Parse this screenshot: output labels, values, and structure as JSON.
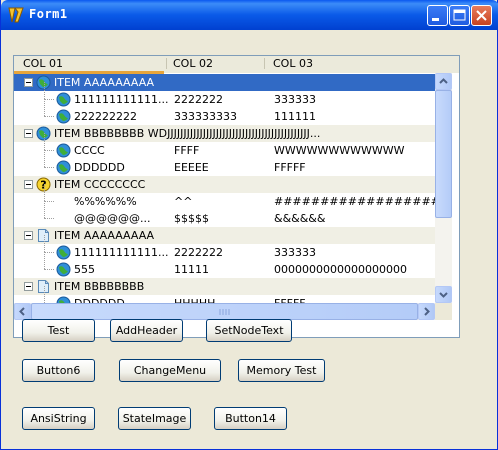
{
  "window": {
    "title": "Form1"
  },
  "columns": [
    "COL 01",
    "COL 02",
    "COL 03"
  ],
  "rows": [
    {
      "level": 0,
      "icon": "globe-icon",
      "c1": "ITEM  AAAAAAAAA",
      "c2": "",
      "c3": "",
      "selected": true
    },
    {
      "level": 1,
      "icon": "globe-icon",
      "c1": "111111111111...",
      "c2": "2222222",
      "c3": "333333"
    },
    {
      "level": 1,
      "icon": "globe-icon",
      "c1": "222222222",
      "c2": "333333333",
      "c3": "111111"
    },
    {
      "level": 0,
      "icon": "globe-icon",
      "c1": "ITEM  BBBBBBBB WDJJJJJJJJJJJJJJJJJJJJJJJJJJJJJJJJJJJJJJJJJJJJ...",
      "c2": "",
      "c3": ""
    },
    {
      "level": 1,
      "icon": "globe-icon",
      "c1": "CCCC",
      "c2": "FFFF",
      "c3": "WWWWWWWWWWWW"
    },
    {
      "level": 1,
      "icon": "globe-icon",
      "c1": "DDDDDD",
      "c2": "EEEEE",
      "c3": "FFFFF"
    },
    {
      "level": 0,
      "icon": "question-icon",
      "c1": "ITEM  CCCCCCCC",
      "c2": "",
      "c3": ""
    },
    {
      "level": 1,
      "icon": "",
      "c1": "%%%%%%",
      "c2": "^^",
      "c3": "##############################"
    },
    {
      "level": 1,
      "icon": "",
      "c1": "@@@@@@...",
      "c2": "$$$$$",
      "c3": "&&&&&&"
    },
    {
      "level": 0,
      "icon": "document-icon",
      "c1": "ITEM  AAAAAAAAA",
      "c2": "",
      "c3": ""
    },
    {
      "level": 1,
      "icon": "globe-icon",
      "c1": "111111111111...",
      "c2": "2222222",
      "c3": "333333"
    },
    {
      "level": 1,
      "icon": "globe-icon",
      "c1": "555",
      "c2": "11111",
      "c3": "0000000000000000000"
    },
    {
      "level": 0,
      "icon": "document-icon",
      "c1": "ITEM  BBBBBBBB",
      "c2": "",
      "c3": ""
    },
    {
      "level": 1,
      "icon": "globe-icon",
      "c1": "DDDDDD",
      "c2": "HHHHH",
      "c3": "FFFFF"
    }
  ],
  "buttons": {
    "test": "Test",
    "add_header": "AddHeader",
    "set_node_text": "SetNodeText",
    "button6": "Button6",
    "change_menu": "ChangeMenu",
    "memory_test": "Memory Test",
    "ansi_string": "AnsiString",
    "state_image": "StateImage",
    "button14": "Button14"
  },
  "colors": {
    "selection": "#316ac5",
    "header_underline": "#e8a53a",
    "title_bar": "#0a5ae8"
  }
}
